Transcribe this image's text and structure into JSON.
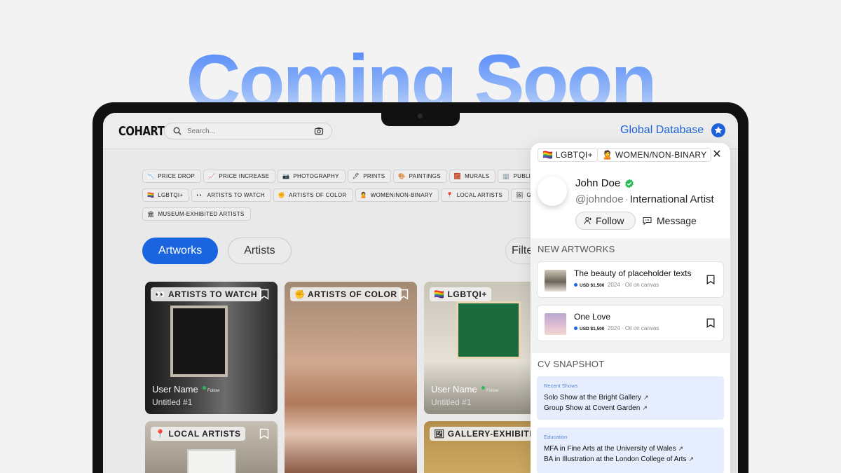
{
  "hero": {
    "title": "Coming Soon"
  },
  "app": {
    "logo": "COHART",
    "search": {
      "placeholder": "Search..."
    },
    "global_database": "Global Database"
  },
  "filters": [
    {
      "emoji": "📉",
      "label": "PRICE DROP"
    },
    {
      "emoji": "📈",
      "label": "PRICE INCREASE"
    },
    {
      "emoji": "📷",
      "label": "PHOTOGRAPHY"
    },
    {
      "emoji": "🖊",
      "label": "PRINTS"
    },
    {
      "emoji": "🎨",
      "label": "PAINTINGS"
    },
    {
      "emoji": "🧱",
      "label": "MURALS"
    },
    {
      "emoji": "🏢",
      "label": "PUBLIC AR"
    },
    {
      "emoji": "🏳️‍🌈",
      "label": "LGBTQI+"
    },
    {
      "emoji": "👀",
      "label": "ARTISTS TO WATCH"
    },
    {
      "emoji": "✊",
      "label": "ARTISTS OF COLOR"
    },
    {
      "emoji": "🙎",
      "label": "WOMEN/NON-BINARY"
    },
    {
      "emoji": "📍",
      "label": "LOCAL ARTISTS"
    },
    {
      "emoji": "🖼",
      "label": "GALL"
    },
    {
      "emoji": "🏛",
      "label": "MUSEUM-EXHIBITED ARTISTS"
    }
  ],
  "tabs": {
    "artworks": "Artworks",
    "artists": "Artists",
    "filter": "Filte"
  },
  "cards": [
    {
      "tag": "👀 ARTISTS TO WATCH",
      "user": "User Name",
      "follow": "Follow",
      "title": "Untitled #1"
    },
    {
      "tag": "✊ ARTISTS OF COLOR"
    },
    {
      "tag": "🏳️‍🌈 LGBTQI+",
      "user": "User Name",
      "follow": "Follow",
      "title": "Untitled #1"
    },
    {
      "tag": "📍 LOCAL ARTISTS"
    },
    {
      "tag": "🖼 GALLERY-EXHIBITED"
    }
  ],
  "panel": {
    "chips": [
      "🏳️‍🌈 LGBTQI+",
      "🙎 WOMEN/NON-BINARY"
    ],
    "name": "John Doe",
    "handle": "@johndoe",
    "separator": "·",
    "role": "International Artist",
    "follow": "Follow",
    "message": "Message",
    "new_artworks_header": "NEW ARTWORKS",
    "artworks": [
      {
        "title": "The beauty of placeholder texts",
        "price": "USD $1,500",
        "year": "2024",
        "medium": "Oil on canvas"
      },
      {
        "title": "One Love",
        "price": "USD $1,500",
        "year": "2024",
        "medium": "Oil on canvas"
      }
    ],
    "meta_separator": "·",
    "cv_header": "CV SNAPSHOT",
    "recent_shows_label": "Recent Shows",
    "recent_shows": [
      "Solo Show at the Bright Gallery",
      "Group Show at Covent Garden"
    ],
    "education_label": "Education",
    "education": [
      "MFA in Fine Arts at the University of Wales",
      "BA in Illustration at the London College of Arts"
    ],
    "link_arrow": "↗"
  },
  "colors": {
    "accent": "#1a64e0",
    "hero_gradient_top": "#4f86f7",
    "verified": "#2dbb5a"
  }
}
